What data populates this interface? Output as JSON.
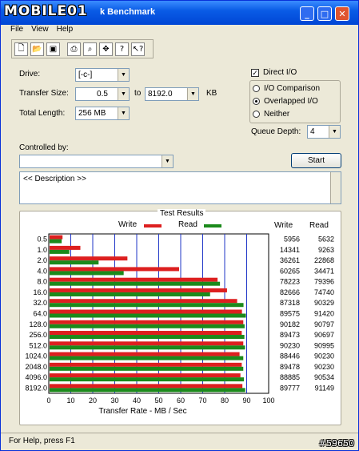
{
  "window": {
    "title": "Untitled - ATTO Disk Benchmark",
    "title_visible": "k Benchmark",
    "logo": "MOBILE01"
  },
  "titlebar_buttons": {
    "minimize": "_",
    "maximize": "□",
    "close": "✕"
  },
  "menu": [
    "File",
    "View",
    "Help"
  ],
  "toolbar": [
    "new-file-icon",
    "open-folder-icon",
    "save-icon",
    "print-icon",
    "print-preview-icon",
    "move-icon",
    "help-icon",
    "context-help-icon"
  ],
  "form": {
    "drive_label": "Drive:",
    "drive_value": "[-c-]",
    "transfer_size_label": "Transfer Size:",
    "transfer_min": "0.5",
    "to_label": "to",
    "transfer_max": "8192.0",
    "unit": "KB",
    "total_length_label": "Total Length:",
    "total_length_value": "256 MB",
    "direct_io": "Direct I/O",
    "options": [
      "I/O Comparison",
      "Overlapped I/O",
      "Neither"
    ],
    "selected_option": "Overlapped I/O",
    "queue_depth_label": "Queue Depth:",
    "queue_depth_value": "4",
    "controlled_by_label": "Controlled by:",
    "controlled_by_value": "",
    "start_button": "Start",
    "description": "<< Description >>"
  },
  "results": {
    "title": "Test Results",
    "write_legend": "Write",
    "read_legend": "Read",
    "write_col": "Write",
    "read_col": "Read",
    "write_color": "#dd1f1f",
    "read_color": "#1b8a1b"
  },
  "chart_data": {
    "type": "bar",
    "orientation": "horizontal",
    "categories": [
      "0.5",
      "1.0",
      "2.0",
      "4.0",
      "8.0",
      "16.0",
      "32.0",
      "64.0",
      "128.0",
      "256.0",
      "512.0",
      "1024.0",
      "2048.0",
      "4096.0",
      "8192.0"
    ],
    "series": [
      {
        "name": "Write",
        "values": [
          5.9,
          14.0,
          35.4,
          58.9,
          76.4,
          80.7,
          85.3,
          87.5,
          88.1,
          87.4,
          88.1,
          86.4,
          87.4,
          86.8,
          87.7
        ]
      },
      {
        "name": "Read",
        "values": [
          5.5,
          9.0,
          22.3,
          33.7,
          77.5,
          73.0,
          88.2,
          89.3,
          88.7,
          88.6,
          88.9,
          88.1,
          88.1,
          88.4,
          89.0
        ]
      }
    ],
    "table_write": [
      "5956",
      "14341",
      "36261",
      "60265",
      "78223",
      "82666",
      "87318",
      "89575",
      "90182",
      "89473",
      "90230",
      "88446",
      "89478",
      "88885",
      "89777"
    ],
    "table_read": [
      "5632",
      "9263",
      "22868",
      "34471",
      "79396",
      "74740",
      "90329",
      "91420",
      "90797",
      "90697",
      "90995",
      "90230",
      "90230",
      "90534",
      "91149"
    ],
    "xlabel": "Transfer Rate - MB / Sec",
    "xticks": [
      "0",
      "10",
      "20",
      "30",
      "40",
      "50",
      "60",
      "70",
      "80",
      "90",
      "100"
    ],
    "xlim": [
      0,
      100
    ],
    "grid": "vertical"
  },
  "status": "For Help, press F1",
  "watermark": "#59650"
}
